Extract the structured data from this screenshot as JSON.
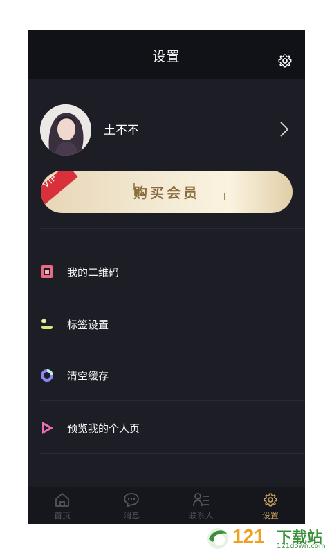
{
  "header": {
    "title": "设置",
    "settings_icon": "gear-icon"
  },
  "profile": {
    "name": "土不不"
  },
  "vip": {
    "badge": "VIP",
    "label": "购买会员"
  },
  "menu": [
    {
      "label": "我的二维码",
      "icon": "qrcode-icon",
      "color": "#e96a82"
    },
    {
      "label": "标签设置",
      "icon": "tag-settings-icon",
      "color": "#d9e87a"
    },
    {
      "label": "清空缓存",
      "icon": "clear-cache-icon",
      "color": "#8f86f2"
    },
    {
      "label": "预览我的个人页",
      "icon": "preview-icon",
      "color": "#e86fb0"
    }
  ],
  "tabs": [
    {
      "label": "首页",
      "icon": "home-icon"
    },
    {
      "label": "消息",
      "icon": "message-icon"
    },
    {
      "label": "联系人",
      "icon": "contacts-icon"
    },
    {
      "label": "设置",
      "icon": "settings-icon",
      "active": true
    }
  ],
  "watermark": {
    "number": "121",
    "text": "下载站",
    "url": "121down.com"
  },
  "colors": {
    "accent_gold": "#c9a15e",
    "bg": "#1d1d26"
  }
}
